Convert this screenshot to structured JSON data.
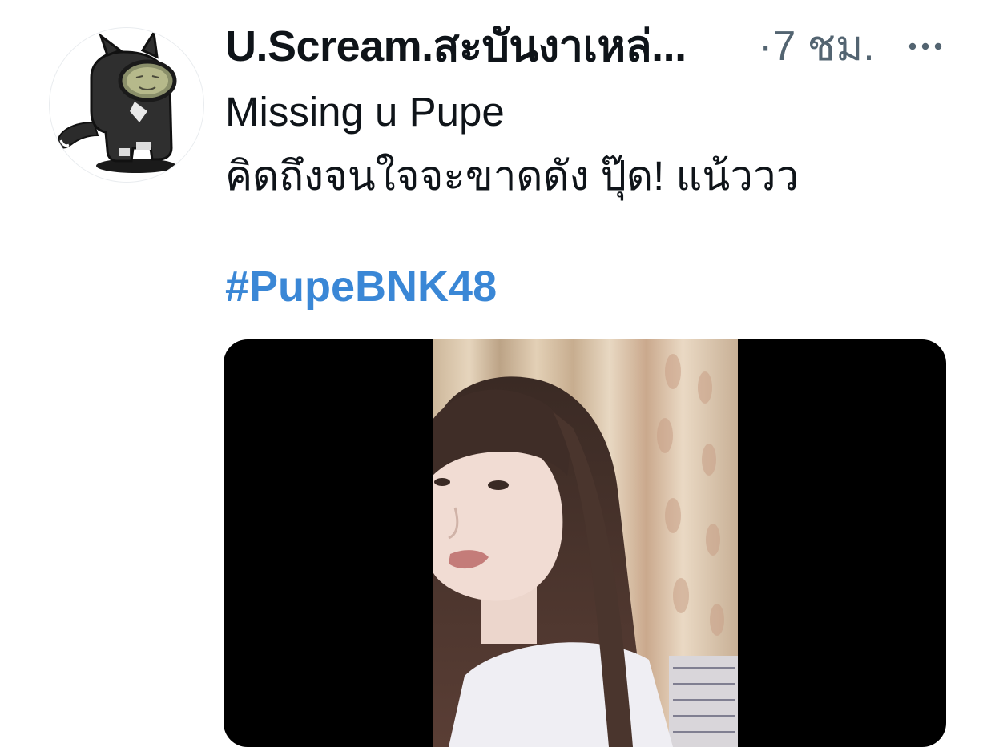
{
  "tweet": {
    "author": {
      "display_name": "U.Scream.สะบันงาเหล่...",
      "avatar_icon": "cat-astronaut-avatar-icon"
    },
    "meta": "·7 ชม.",
    "more_icon": "more-dots-icon",
    "text_lines": [
      "Missing u Pupe",
      "คิดถึงจนใจจะขาดดัง ปุ๊ด! แน้ววว"
    ],
    "hashtag": "#PupeBNK48",
    "media": {
      "type": "video",
      "background": "#000000"
    }
  },
  "colors": {
    "text": "#0f1419",
    "secondary": "#536471",
    "link": "#3a87d6"
  }
}
